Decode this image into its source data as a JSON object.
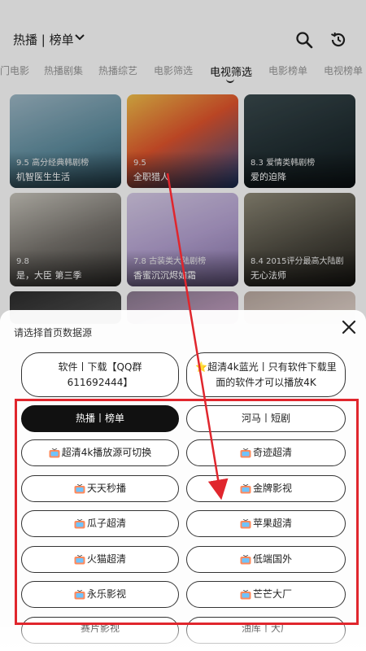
{
  "header": {
    "title": "热播 | 榜单"
  },
  "tabs": [
    "门电影",
    "热播剧集",
    "热播综艺",
    "电影筛选",
    "电视筛选",
    "电影榜单",
    "电视榜单"
  ],
  "active_tab": "电视筛选",
  "cards": [
    {
      "rating": "9.5 高分经典韩剧榜",
      "title": "机智医生生活"
    },
    {
      "rating": "9.5",
      "title": "全职猎人"
    },
    {
      "rating": "8.3 爱情类韩剧榜",
      "title": "爱的迫降"
    },
    {
      "rating": "9.8",
      "title": "是，大臣 第三季"
    },
    {
      "rating": "7.8 古装类大陆剧榜",
      "title": "香蜜沉沉烬如霜"
    },
    {
      "rating": "8.4 2015评分最高大陆剧",
      "title": "无心法师"
    }
  ],
  "sheet": {
    "title": "请选择首页数据源",
    "top_pills": [
      "软件丨下载【QQ群611692444】",
      "⭐超清4k蓝光丨只有软件下载里面的软件才可以播放4K"
    ],
    "sources": [
      "热播丨榜单",
      "河马丨短剧",
      "超清4k播放源可切换",
      "奇迹超清",
      "天天秒播",
      "金牌影视",
      "瓜子超清",
      "苹果超清",
      "火猫超清",
      "低端国外",
      "永乐影视",
      "芒芒大厂",
      "赛片影视",
      "油库丨大厂"
    ],
    "selected_source": "热播丨榜单"
  },
  "colors": {
    "annotation": "#e0262d",
    "selected_pill": "#111111"
  },
  "icons": [
    "search-icon",
    "history-icon",
    "close-icon",
    "tv-icon",
    "chevron-down-icon"
  ]
}
